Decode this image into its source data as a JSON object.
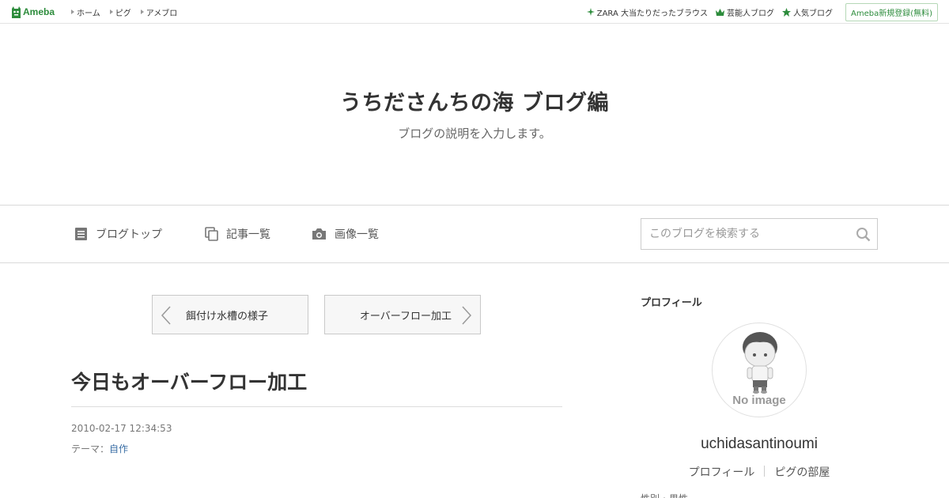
{
  "topbar": {
    "logo_text": "Ameba",
    "nav": [
      "ホーム",
      "ピグ",
      "アメブロ"
    ],
    "right_links": [
      {
        "icon": "sparkle-icon",
        "label": "ZARA 大当たりだったブラウス"
      },
      {
        "icon": "crown-icon",
        "label": "芸能人ブログ"
      },
      {
        "icon": "star-icon",
        "label": "人気ブログ"
      }
    ],
    "register_label": "Ameba新規登録(無料)"
  },
  "header": {
    "title": "うちださんちの海 ブログ編",
    "description": "ブログの説明を入力します。"
  },
  "nav": {
    "items": [
      {
        "icon": "document-icon",
        "label": "ブログトップ"
      },
      {
        "icon": "copy-icon",
        "label": "記事一覧"
      },
      {
        "icon": "camera-icon",
        "label": "画像一覧"
      }
    ],
    "search_placeholder": "このブログを検索する"
  },
  "pager": {
    "prev_label": "餌付け水槽の様子",
    "next_label": "オーバーフロー加工"
  },
  "entry": {
    "title": "今日もオーバーフロー加工",
    "date": "2010-02-17 12:34:53",
    "theme_label": "テーマ：",
    "theme_value": "自作"
  },
  "sidebar": {
    "heading": "プロフィール",
    "avatar_text": "No image",
    "username": "uchidasantinoumi",
    "links": [
      "プロフィール",
      "ピグの部屋"
    ],
    "cut_text": "性別・男性"
  },
  "colors": {
    "brand_green": "#2d8c3c",
    "link_blue": "#3a6ea5"
  }
}
